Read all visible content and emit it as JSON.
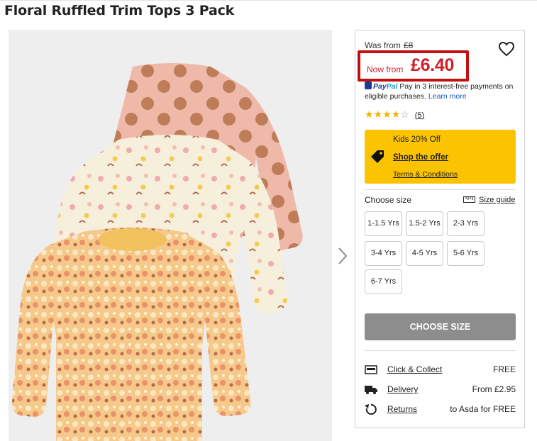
{
  "product": {
    "title": "Floral Ruffled Trim Tops 3 Pack"
  },
  "price": {
    "was_label": "Was from",
    "was_value": "£8",
    "now_label": "Now from",
    "now_value": "£6.40"
  },
  "paypal": {
    "brand_part1": "Pay",
    "brand_part2": "Pal",
    "text": "Pay in 3 interest-free payments on eligible purchases.",
    "learn_more": "Learn more"
  },
  "rating": {
    "stars": 4,
    "max": 5,
    "count": "5"
  },
  "offer": {
    "title": "Kids 20% Off",
    "link": "Shop the offer",
    "terms": "Terms & Conditions",
    "color": "#fcc400"
  },
  "sizes": {
    "label": "Choose size",
    "guide": "Size guide",
    "options": [
      "1-1.5 Yrs",
      "1.5-2 Yrs",
      "2-3 Yrs",
      "3-4 Yrs",
      "4-5 Yrs",
      "5-6 Yrs",
      "6-7 Yrs"
    ]
  },
  "cta": {
    "label": "CHOOSE SIZE"
  },
  "delivery": [
    {
      "icon": "store-icon",
      "label": "Click & Collect",
      "value": "FREE"
    },
    {
      "icon": "truck-icon",
      "label": "Delivery",
      "value": "From £2.95"
    },
    {
      "icon": "returns-icon",
      "label": "Returns",
      "value": "to Asda for FREE"
    }
  ],
  "colors": {
    "price_red": "#d0202a",
    "highlight_border": "#c21010",
    "button_grey": "#8d8d8d"
  }
}
